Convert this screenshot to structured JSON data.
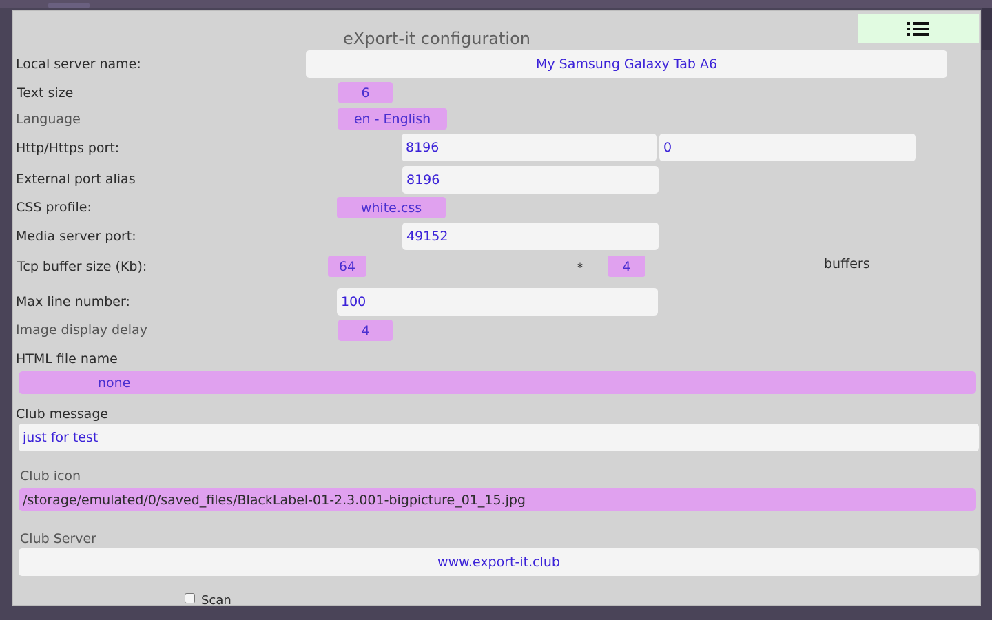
{
  "window": {
    "title": "eXport-it configuration"
  },
  "menu": {
    "icon": "list-menu-icon"
  },
  "colors": {
    "panel_bg": "#d3d3d3",
    "menu_bg": "#e1fbe1",
    "chip_bg": "#e0a1ef",
    "input_text": "#3b22d8",
    "input_bg": "#f4f4f4"
  },
  "settings": {
    "local_server_name": {
      "label": "Local server name:",
      "value": "My Samsung Galaxy Tab A6"
    },
    "text_size": {
      "label": "Text size",
      "value": "6"
    },
    "language": {
      "label": "Language",
      "value": "en - English"
    },
    "http_port": {
      "label": "Http/Https port:",
      "value_http": "8196",
      "value_https": "0"
    },
    "external_port_alias": {
      "label": "External port alias",
      "value": "8196"
    },
    "css_profile": {
      "label": "CSS profile:",
      "value": "white.css"
    },
    "media_server_port": {
      "label": "Media server port:",
      "value": "49152"
    },
    "tcp_buffer": {
      "label": "Tcp buffer size (Kb):",
      "size": "64",
      "multiplier": "*",
      "count": "4",
      "suffix": "buffers"
    },
    "max_line_number": {
      "label": "Max line number:",
      "value": "100"
    },
    "image_display_delay": {
      "label": "Image display delay",
      "value": "4"
    },
    "html_file_name": {
      "label": "HTML file name",
      "value": "none"
    },
    "club_message": {
      "label": "Club message",
      "value": "just for test"
    },
    "club_icon": {
      "label": "Club icon",
      "value": "/storage/emulated/0/saved_files/BlackLabel-01-2.3.001-bigpicture_01_15.jpg"
    },
    "club_server": {
      "label": "Club Server",
      "value": "www.export-it.club"
    },
    "scan": {
      "label": "Scan",
      "checked": false
    }
  }
}
